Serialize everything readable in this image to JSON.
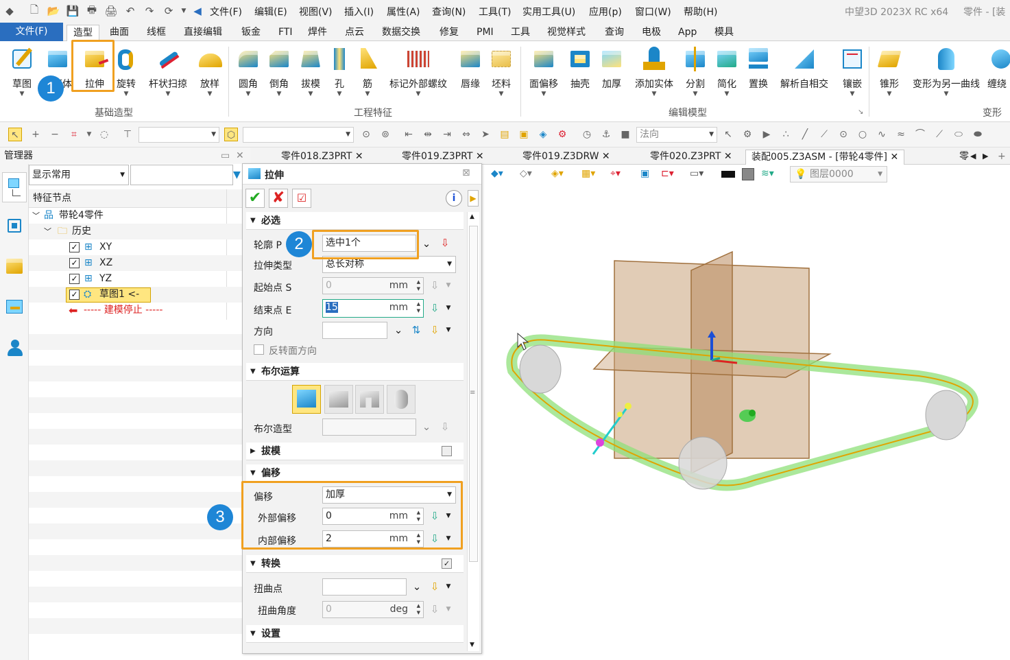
{
  "menubar": {
    "items": [
      "文件(F)",
      "编辑(E)",
      "视图(V)",
      "插入(I)",
      "属性(A)",
      "查询(N)",
      "工具(T)",
      "实用工具(U)",
      "应用(p)",
      "窗口(W)",
      "帮助(H)"
    ],
    "app_title": "中望3D 2023X RC x64",
    "doc_title": "零件 - [装"
  },
  "tabs": {
    "file": "文件(F)",
    "items": [
      "造型",
      "曲面",
      "线框",
      "直接编辑",
      "钣金",
      "FTI",
      "焊件",
      "点云",
      "数据交换",
      "修复",
      "PMI",
      "工具",
      "视觉样式",
      "查询",
      "电极",
      "App",
      "模具"
    ]
  },
  "ribbon": {
    "basic": [
      "草图",
      "六面体",
      "拉伸",
      "旋转",
      "杆状扫掠",
      "放样"
    ],
    "basic_group": "基础造型",
    "eng": [
      "圆角",
      "倒角",
      "拔模",
      "孔",
      "筋",
      "标记外部螺纹",
      "唇缘",
      "坯料"
    ],
    "eng_group": "工程特征",
    "edit": [
      "面偏移",
      "抽壳",
      "加厚",
      "添加实体",
      "分割",
      "简化",
      "置换",
      "解析自相交",
      "镶嵌"
    ],
    "edit_group": "编辑模型",
    "deform": [
      "锥形",
      "变形为另一曲线",
      "缠绕"
    ],
    "deform_group": "变形"
  },
  "toolbar2": {
    "normal_combo": "法向"
  },
  "manager": {
    "title": "管理器",
    "filter": "显示常用",
    "column": "特征节点",
    "root": "带轮4零件",
    "history": "历史",
    "items": [
      "XY",
      "XZ",
      "YZ",
      "草图1 <-"
    ],
    "stop": "----- 建模停止 -----"
  },
  "doctabs": [
    "零件018.Z3PRT",
    "零件019.Z3PRT",
    "零件019.Z3DRW",
    "零件020.Z3PRT",
    "装配005.Z3ASM - [带轮4零件]",
    "零"
  ],
  "viewtb": {
    "layer": "图层0000"
  },
  "panel": {
    "title": "拉伸",
    "sec_required": "必选",
    "profile_label": "轮廓 P",
    "profile_value": "选中1个",
    "type_label": "拉伸类型",
    "type_value": "总长对称",
    "start_label": "起始点 S",
    "start_value": "0",
    "end_label": "结束点 E",
    "end_value": "15",
    "unit_mm": "mm",
    "unit_deg": "deg",
    "dir_label": "方向",
    "reverse_label": "反转面方向",
    "sec_bool": "布尔运算",
    "bool_shape_label": "布尔造型",
    "sec_draft": "拔模",
    "sec_offset": "偏移",
    "offset_label": "偏移",
    "offset_value": "加厚",
    "outer_label": "外部偏移",
    "outer_value": "0",
    "inner_label": "内部偏移",
    "inner_value": "2",
    "sec_transform": "转换",
    "twist_point_label": "扭曲点",
    "twist_angle_label": "扭曲角度",
    "twist_angle_value": "0",
    "sec_settings": "设置"
  },
  "badges": [
    "1",
    "2",
    "3"
  ],
  "colors": {
    "accent": "#2a6ebf",
    "highlight": "#f0a020",
    "badge": "#1e86d6",
    "belt": "#8fe07a",
    "plane": "#c9a27a"
  }
}
